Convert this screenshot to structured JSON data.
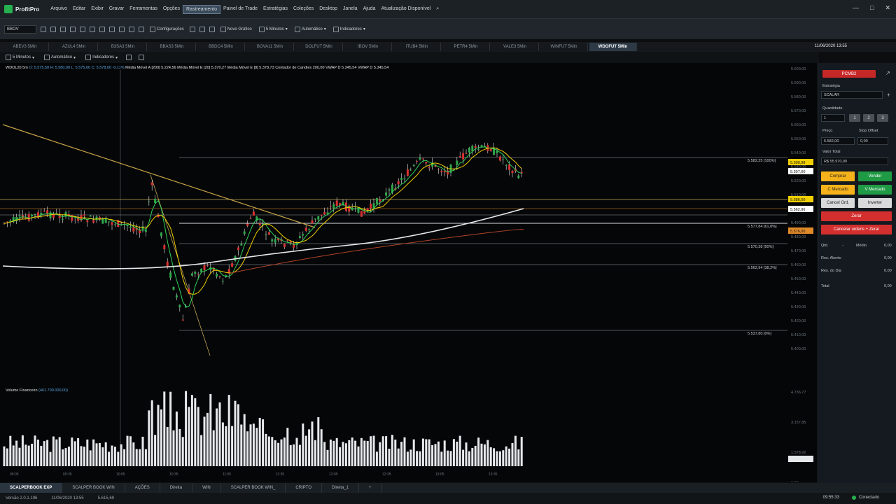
{
  "app": {
    "name": "ProfitPro"
  },
  "menu": [
    "Arquivo",
    "Editar",
    "Exibir",
    "Gravar",
    "Ferramentas",
    "Opções",
    "Rastreamento",
    "Painel de Trade",
    "Estratégias",
    "Coleções",
    "Desktop",
    "Janela",
    "Ajuda",
    "Atualização Disponível"
  ],
  "menu_active": 6,
  "toolbar": {
    "symbol": "BBOV",
    "settings_label": "Configurações",
    "new_chart": "Novo Gráfico",
    "period": "5 Minutos",
    "mode": "Automático",
    "indicators": "Indicadores"
  },
  "tabs": [
    "ABEV3 5Min",
    "AZUL4 5Min",
    "B3SA3 5Min",
    "BBAS3 5Min",
    "BBDC4 5Min",
    "BOVA11 5Min",
    "DOLFUT 5Min",
    "IBOV 5Min",
    "ITUB4 5Min",
    "PETR4 5Min",
    "VALE3 5Min",
    "WINFUT 5Min",
    "WDOFUT 5Min"
  ],
  "active_tab": 12,
  "datetime": "11/06/2020 13:55",
  "chart_toolbar": {
    "period": "5 Minutos",
    "mode": "Automático",
    "indicators": "Indicadores"
  },
  "legend": {
    "symbol": "WDOL20 5m",
    "ohlc": "O: 5.575,50  H: 5.580,00  L: 5.575,00  C: 5.578,00  -0.11%",
    "ma1": "Média Móvel A [200] 5.224,56",
    "ma2": "Média Móvel E [20] 5.370,27",
    "ma3": "Média Móvel E [8] 5.378,73",
    "counter": "Contador de Candles 200,00",
    "vwap1": "VWAP D 5.345,54",
    "vwap2": "VWAP D 5.345,54"
  },
  "price_axis": [
    "5.600,00",
    "5.590,00",
    "5.580,00",
    "5.570,00",
    "5.560,00",
    "5.550,00",
    "5.540,00",
    "5.530,00",
    "5.520,00",
    "5.510,00",
    "5.500,00",
    "5.490,00",
    "5.480,00",
    "5.470,00",
    "5.460,00",
    "5.450,00",
    "5.440,00",
    "5.430,00",
    "5.420,00",
    "5.410,00",
    "5.400,00"
  ],
  "volume_axis": [
    "4.736,77",
    "3.157,85",
    "1.578,92",
    "0,00"
  ],
  "fib_labels": [
    "5.582,25 [100%]",
    "5.577,84 [61,8%]",
    "5.570,38 [50%]",
    "5.562,94 [38,2%]",
    "5.537,80 [0%]"
  ],
  "price_tags": [
    {
      "text": "5.590,98",
      "color": "#f0d000"
    },
    {
      "text": "5.597,00",
      "color": "#ffffff"
    },
    {
      "text": "5.586,00",
      "color": "#f0d000"
    },
    {
      "text": "5.562,96",
      "color": "#ffffff"
    },
    {
      "text": "5.576,00",
      "color": "#e08a2a"
    }
  ],
  "time_axis": [
    "09:05",
    "09:35",
    "10:05",
    "10:35",
    "11:05",
    "11:35",
    "12:05",
    "12:35",
    "13:05",
    "13:35"
  ],
  "volume_title": "Volume Financeiro",
  "volume_value": "(461.790.000,00)",
  "right_panel": {
    "account": "PCMB2",
    "strategy_label": "Estratégia",
    "strategy_value": "SCALAR",
    "quantity_label": "Quantidade",
    "quantity_value": "1",
    "qty_btns": [
      "1",
      "2",
      "3"
    ],
    "price_label": "Preço",
    "price_value": "5.582,00",
    "stop_label": "Stop Offset",
    "stop_value": "0,00",
    "total_label": "Valor Total",
    "total_value": "R$ 55.970,00",
    "buy": "Comprar",
    "sell": "Vender",
    "buy_market": "C Mercado",
    "sell_market": "V Mercado",
    "cancel_orders": "Cancel Ord.",
    "invert": "Inverter",
    "zero": "Zerar",
    "cancel_zero": "Cancelar ordens + Zerar",
    "rows": [
      {
        "label": "Qtd.",
        "value": "-"
      },
      {
        "label": "Médio",
        "value": "0,00"
      },
      {
        "label": "Res. Aberto",
        "value": "0,00"
      },
      {
        "label": "Res. do Dia",
        "value": "0,00"
      },
      {
        "label": "Total",
        "value": "0,00"
      }
    ]
  },
  "bottom_tabs": [
    "SCALPERBOOK EXP",
    "SCALPER BOOK WIN",
    "AÇÕES",
    "Direita",
    "WIN",
    "SCALPER BOOK WIN_",
    "CRIPTO",
    "Direita_1"
  ],
  "active_bottom_tab": 0,
  "status": {
    "version": "Versão 2.0.1.196",
    "date": "11/06/2020 13:55",
    "value": "5.615,69",
    "conn": "Conectado",
    "clock": "09:55:33"
  },
  "colors": {
    "up": "#2fa64a",
    "down": "#d83131",
    "accent": "#26b050"
  }
}
